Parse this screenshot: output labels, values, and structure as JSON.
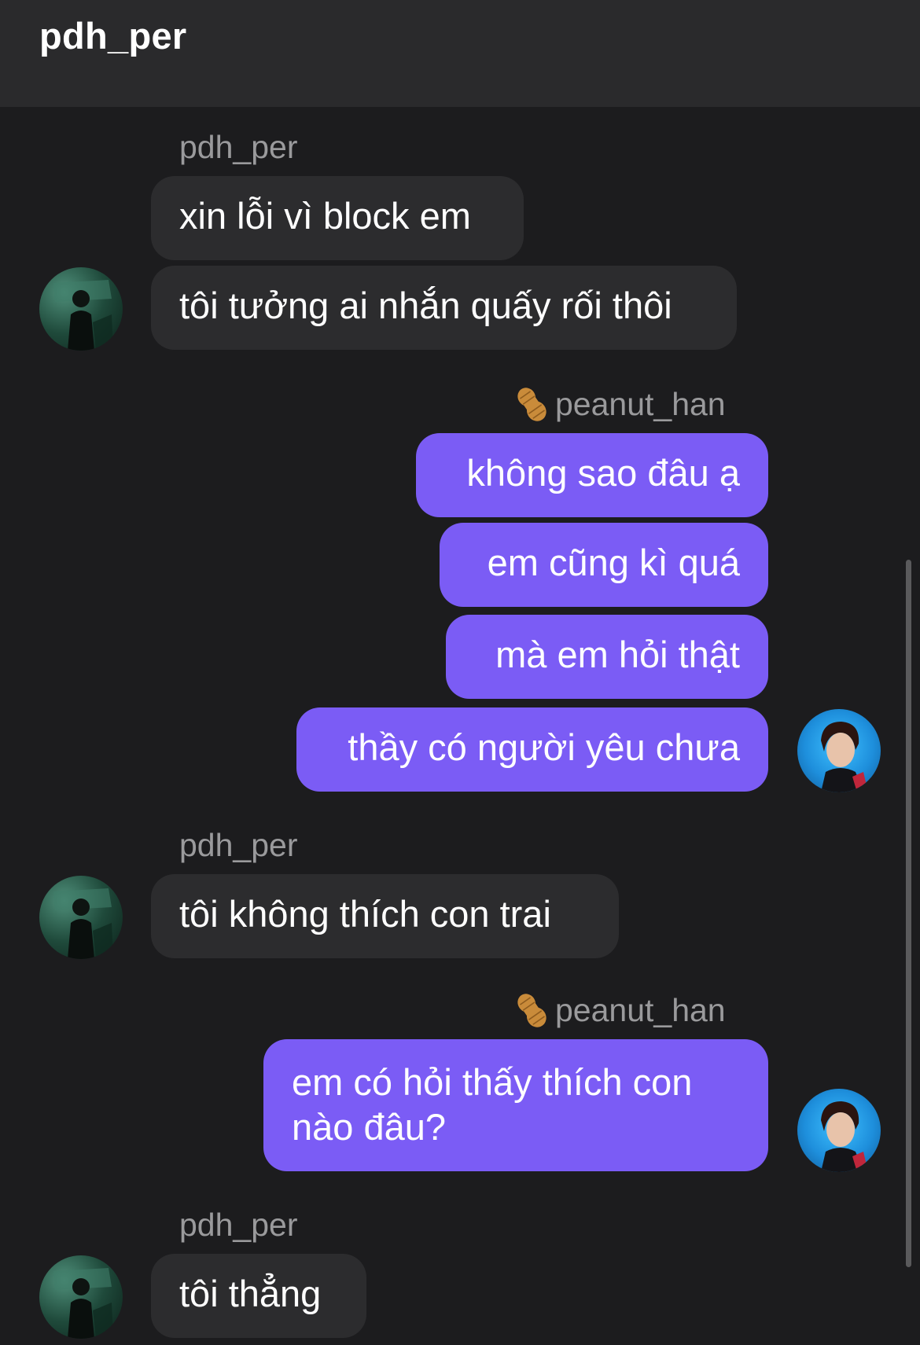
{
  "header": {
    "title": "pdh_per"
  },
  "messages": {
    "group1": {
      "sender": "pdh_per",
      "lines": [
        "xin lỗi vì block em",
        "tôi tưởng ai nhắn quấy rối thôi"
      ]
    },
    "group2": {
      "sender": "peanut_han",
      "lines": [
        "không sao đâu ạ",
        "em cũng kì quá",
        "mà em hỏi thật",
        "thầy có người yêu chưa"
      ]
    },
    "group3": {
      "sender": "pdh_per",
      "lines": [
        "tôi không thích con trai"
      ]
    },
    "group4": {
      "sender": "peanut_han",
      "lines": [
        "em có hỏi thấy thích con nào đâu?"
      ]
    },
    "group5": {
      "sender": "pdh_per",
      "lines": [
        "tôi thẳng"
      ]
    }
  },
  "colors": {
    "background": "#1c1c1e",
    "header": "#2a2a2c",
    "incoming_bubble": "#2c2c2e",
    "outgoing_bubble": "#7b5cf5",
    "username": "#9a9a9c"
  },
  "icons": {
    "sender_badge": "peanut-icon",
    "avatars": [
      "avatar-pdh-per",
      "avatar-peanut-han"
    ]
  }
}
